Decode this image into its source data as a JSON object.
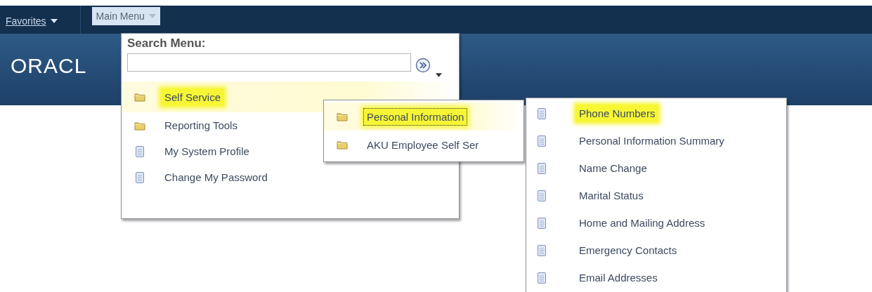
{
  "nav": {
    "favorites": "Favorites",
    "main_menu": "Main Menu",
    "main_menu_open": true
  },
  "header": {
    "logo": "ORACL"
  },
  "main_menu": {
    "search_label": "Search Menu:",
    "items": [
      {
        "label": "Self Service",
        "kind": "folder",
        "selected": true,
        "highlighted": true
      },
      {
        "label": "Reporting Tools",
        "kind": "folder",
        "selected": false,
        "highlighted": false
      },
      {
        "label": "My System Profile",
        "kind": "page",
        "selected": false,
        "highlighted": false
      },
      {
        "label": "Change My Password",
        "kind": "page",
        "selected": false,
        "highlighted": false
      }
    ]
  },
  "submenu": {
    "items": [
      {
        "label": "Personal Information",
        "kind": "folder",
        "selected": true,
        "highlighted": true
      },
      {
        "label": "AKU Employee Self Ser",
        "kind": "folder",
        "selected": false,
        "highlighted": false
      }
    ]
  },
  "subsubmenu": {
    "items": [
      {
        "label": "Phone Numbers",
        "kind": "page",
        "selected": false,
        "highlighted": true
      },
      {
        "label": "Personal Information Summary",
        "kind": "page",
        "selected": false,
        "highlighted": false
      },
      {
        "label": "Name Change",
        "kind": "page",
        "selected": false,
        "highlighted": false
      },
      {
        "label": "Marital Status",
        "kind": "page",
        "selected": false,
        "highlighted": false
      },
      {
        "label": "Home and Mailing Address",
        "kind": "page",
        "selected": false,
        "highlighted": false
      },
      {
        "label": "Emergency Contacts",
        "kind": "page",
        "selected": false,
        "highlighted": false
      },
      {
        "label": "Email Addresses",
        "kind": "page",
        "selected": false,
        "highlighted": false
      }
    ]
  }
}
